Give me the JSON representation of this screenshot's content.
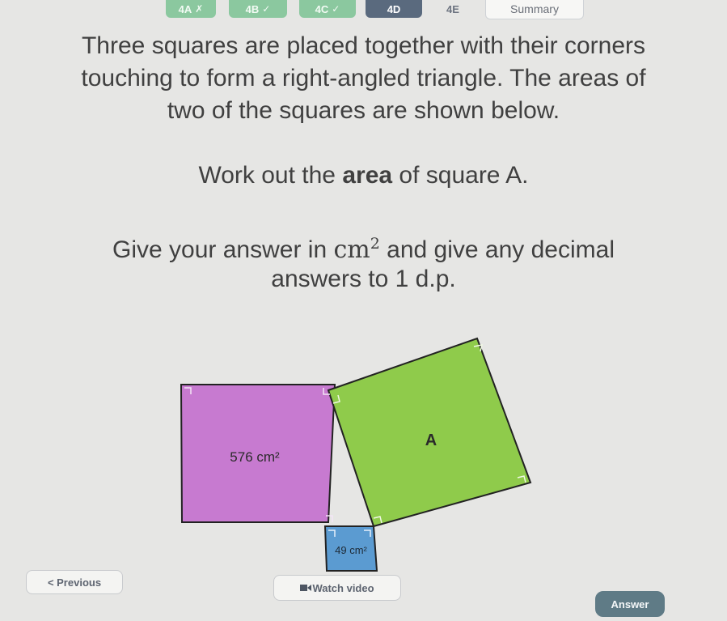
{
  "tabs": [
    {
      "label": "4A",
      "mark": "✗",
      "state": "done"
    },
    {
      "label": "4B",
      "mark": "✓",
      "state": "done"
    },
    {
      "label": "4C",
      "mark": "✓",
      "state": "done"
    },
    {
      "label": "4D",
      "mark": "",
      "state": "active"
    },
    {
      "label": "4E",
      "mark": "",
      "state": "plain"
    },
    {
      "label": "Summary",
      "mark": "",
      "state": "summary"
    }
  ],
  "question": {
    "line1": "Three squares are placed together with their corners",
    "line2": "touching to form a right-angled triangle. The areas of",
    "line3": "two of the squares are shown below.",
    "task_before": "Work out the ",
    "task_bold": "area",
    "task_after": " of square A.",
    "give_before": "Give your answer in ",
    "unit": "cm",
    "unit_power": "2",
    "give_after": " and give any decimal",
    "give_line2": "answers to 1 d.p."
  },
  "diagram": {
    "purple_label": "576 cm²",
    "green_label": "A",
    "blue_label": "49 cm²",
    "colors": {
      "purple": "#c77ad0",
      "green": "#8fcb4b",
      "blue": "#5b9bd1",
      "outline": "#222222"
    }
  },
  "buttons": {
    "previous": "< Previous",
    "watch_video": "Watch video",
    "answer": "Answer"
  }
}
